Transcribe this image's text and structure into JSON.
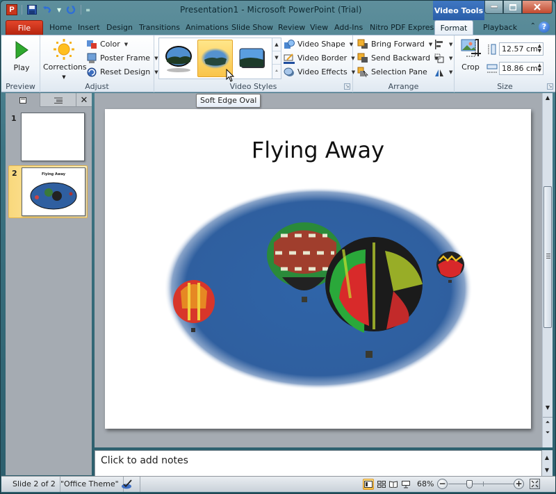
{
  "titlebar": {
    "title": "Presentation1 - Microsoft PowerPoint (Trial)",
    "contextual_tab_group": "Video Tools",
    "app_icon_letter": "P",
    "window_buttons": [
      "minimize",
      "maximize",
      "close"
    ]
  },
  "ribbon_tabs": [
    {
      "label": "File",
      "kind": "file"
    },
    {
      "label": "Home"
    },
    {
      "label": "Insert"
    },
    {
      "label": "Design"
    },
    {
      "label": "Transitions"
    },
    {
      "label": "Animations"
    },
    {
      "label": "Slide Show"
    },
    {
      "label": "Review"
    },
    {
      "label": "View"
    },
    {
      "label": "Add-Ins"
    },
    {
      "label": "Nitro PDF Express"
    },
    {
      "label": "Format",
      "active": true
    },
    {
      "label": "Playback"
    }
  ],
  "help_label": "?",
  "ribbon": {
    "preview": {
      "label": "Preview",
      "play": "Play"
    },
    "adjust": {
      "label": "Adjust",
      "corrections": "Corrections",
      "color": "Color",
      "poster_frame": "Poster Frame",
      "reset_design": "Reset Design"
    },
    "video_styles": {
      "label": "Video Styles",
      "gallery": [
        "Beveled Oval, Black",
        "Soft Edge Oval",
        "Beveled Perspective"
      ],
      "selected_index": 1,
      "video_shape": "Video Shape",
      "video_border": "Video Border",
      "video_effects": "Video Effects"
    },
    "arrange": {
      "label": "Arrange",
      "bring_forward": "Bring Forward",
      "send_backward": "Send Backward",
      "selection_pane": "Selection Pane"
    },
    "size": {
      "label": "Size",
      "crop": "Crop",
      "height": "12.57 cm",
      "width": "18.86 cm"
    }
  },
  "tooltip": "Soft Edge Oval",
  "slides_panel": {
    "slides": [
      {
        "number": "1",
        "title": ""
      },
      {
        "number": "2",
        "title": "Flying Away",
        "selected": true
      }
    ]
  },
  "slide": {
    "title": "Flying Away",
    "video_alt": "Hot air balloons against a blue sky in a soft edge oval frame"
  },
  "notes": {
    "placeholder": "Click to add notes"
  },
  "statusbar": {
    "slide_info": "Slide 2 of 2",
    "theme": "\"Office Theme\"",
    "zoom": "68%",
    "zoom_level_percent": 68,
    "views": [
      "Normal",
      "Slide Sorter",
      "Reading View",
      "Slide Show"
    ],
    "active_view": "Normal"
  }
}
